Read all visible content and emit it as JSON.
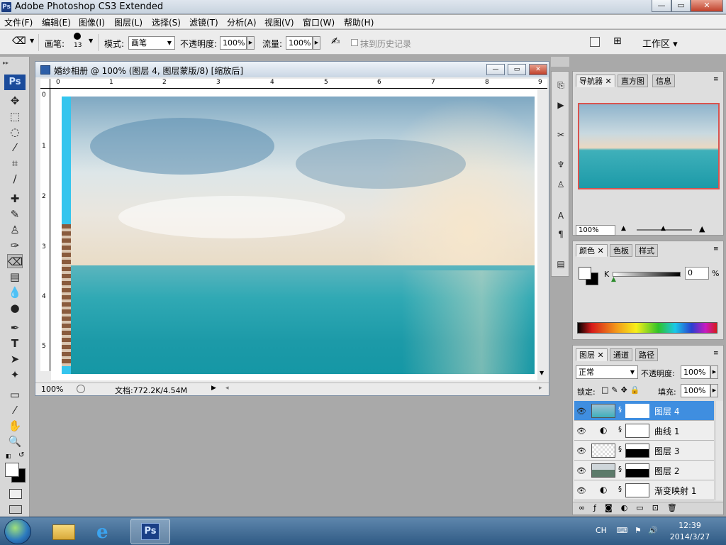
{
  "window": {
    "title": "Adobe Photoshop CS3 Extended",
    "icon_text": "Ps"
  },
  "menu": [
    "文件(F)",
    "编辑(E)",
    "图像(I)",
    "图层(L)",
    "选择(S)",
    "滤镜(T)",
    "分析(A)",
    "视图(V)",
    "窗口(W)",
    "帮助(H)"
  ],
  "options": {
    "brush_label": "画笔:",
    "brush_size": "13",
    "mode_label": "模式:",
    "mode_value": "画笔",
    "opacity_label": "不透明度:",
    "opacity_value": "100%",
    "flow_label": "流量:",
    "flow_value": "100%",
    "history_label": "抹到历史记录",
    "workspace_label": "工作区 ▾"
  },
  "toolbox": {
    "logo": "Ps"
  },
  "document": {
    "title": "婚纱相册 @ 100% (图层 4, 图层蒙版/8) [缩放后]",
    "zoom": "100%",
    "doc_size": "文档:772.2K/4.54M",
    "ruler_top": [
      "0",
      "1",
      "2",
      "3",
      "4",
      "5",
      "6",
      "7",
      "8",
      "9"
    ],
    "ruler_left": [
      "0",
      "1",
      "2",
      "3",
      "4",
      "5"
    ]
  },
  "navigator": {
    "tabs": [
      "导航器",
      "直方图",
      "信息"
    ],
    "zoom": "100%"
  },
  "color_panel": {
    "tabs": [
      "颜色",
      "色板",
      "样式"
    ],
    "channel_label": "K",
    "value": "0",
    "unit": "%"
  },
  "layers_panel": {
    "tabs": [
      "图层",
      "通道",
      "路径"
    ],
    "blend_mode": "正常",
    "opacity_label": "不透明度:",
    "opacity_value": "100%",
    "lock_label": "锁定:",
    "fill_label": "填充:",
    "fill_value": "100%",
    "layers": [
      {
        "name": "图层 4",
        "selected": true
      },
      {
        "name": "曲线 1",
        "selected": false
      },
      {
        "name": "图层 3",
        "selected": false
      },
      {
        "name": "图层 2",
        "selected": false
      },
      {
        "name": "渐变映射 1",
        "selected": false
      }
    ]
  },
  "taskbar": {
    "time": "12:39",
    "date": "2014/3/27",
    "lang": "CH",
    "ps_label": "Ps"
  },
  "colors": {
    "accent": "#3f8ee0",
    "ps_blue": "#1a4b9b",
    "taskbar": "#2f5a84"
  }
}
